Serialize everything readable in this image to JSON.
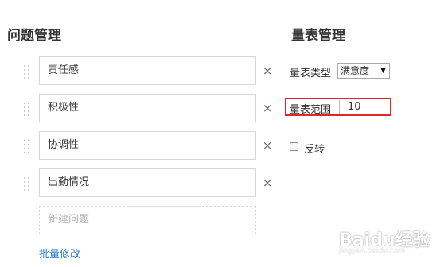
{
  "question_management": {
    "title": "问题管理",
    "questions": [
      {
        "text": "责任感"
      },
      {
        "text": "积极性"
      },
      {
        "text": "协调性"
      },
      {
        "text": "出勤情况"
      }
    ],
    "new_question_placeholder": "新建问题",
    "remove_symbol": "×",
    "batch_edit_label": "批量修改"
  },
  "scale_management": {
    "title": "量表管理",
    "scale_type_label": "量表类型",
    "scale_type_value": "满意度",
    "scale_type_arrow": "▼",
    "scale_range_label": "量表范围",
    "scale_range_value": "10",
    "reverse_label": "反转",
    "reverse_checked": false
  },
  "watermark": {
    "brand": "Baidu经验",
    "url": "jingyan.baidu.com"
  },
  "colors": {
    "link": "#2d7ec8",
    "highlight_box": "#e02626",
    "text": "#333333",
    "border": "#d6d6d6"
  }
}
